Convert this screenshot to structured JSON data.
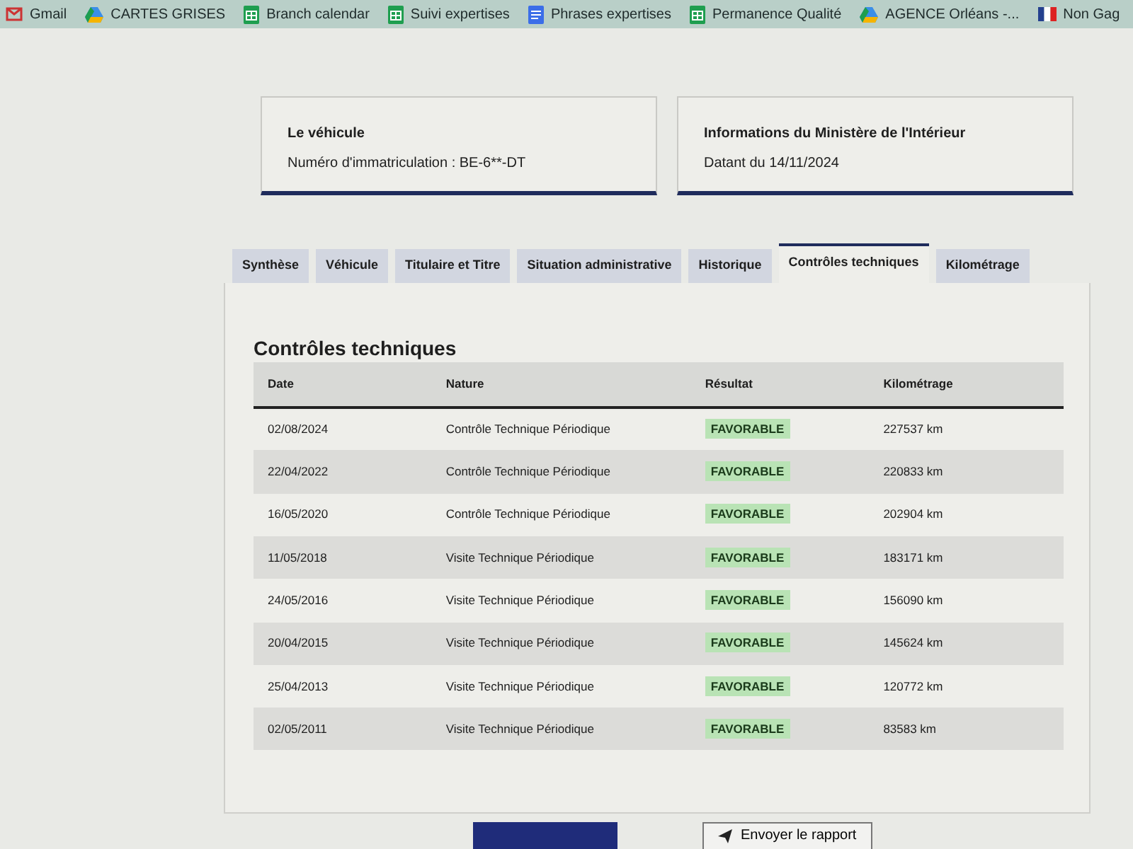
{
  "bookmarks": [
    {
      "label": "Gmail",
      "kind": "mail"
    },
    {
      "label": "CARTES GRISES",
      "kind": "drive"
    },
    {
      "label": "Branch calendar",
      "kind": "sheet"
    },
    {
      "label": "Suivi expertises",
      "kind": "sheet"
    },
    {
      "label": "Phrases expertises",
      "kind": "doc"
    },
    {
      "label": "Permanence Qualité",
      "kind": "sheet"
    },
    {
      "label": "AGENCE Orléans -...",
      "kind": "drive"
    },
    {
      "label": "Non Gag",
      "kind": "flag"
    }
  ],
  "info_cards": [
    {
      "title": "Le véhicule",
      "text": "Numéro d'immatriculation : BE-6**-DT"
    },
    {
      "title": "Informations du Ministère de l'Intérieur",
      "text": "Datant du 14/11/2024"
    }
  ],
  "tabs": [
    {
      "label": "Synthèse",
      "selected": false
    },
    {
      "label": "Véhicule",
      "selected": false
    },
    {
      "label": "Titulaire et Titre",
      "selected": false
    },
    {
      "label": "Situation administrative",
      "selected": false
    },
    {
      "label": "Historique",
      "selected": false
    },
    {
      "label": "Contrôles techniques",
      "selected": true
    },
    {
      "label": "Kilométrage",
      "selected": false
    }
  ],
  "section_title": "Contrôles techniques",
  "table": {
    "columns": [
      "Date",
      "Nature",
      "Résultat",
      "Kilométrage"
    ],
    "rows": [
      {
        "date": "02/08/2024",
        "nature": "Contrôle Technique Périodique",
        "result": "FAVORABLE",
        "mileage": "227537 km"
      },
      {
        "date": "22/04/2022",
        "nature": "Contrôle Technique Périodique",
        "result": "FAVORABLE",
        "mileage": "220833 km"
      },
      {
        "date": "16/05/2020",
        "nature": "Contrôle Technique Périodique",
        "result": "FAVORABLE",
        "mileage": "202904 km"
      },
      {
        "date": "11/05/2018",
        "nature": "Visite Technique Périodique",
        "result": "FAVORABLE",
        "mileage": "183171 km"
      },
      {
        "date": "24/05/2016",
        "nature": "Visite Technique Périodique",
        "result": "FAVORABLE",
        "mileage": "156090 km"
      },
      {
        "date": "20/04/2015",
        "nature": "Visite Technique Périodique",
        "result": "FAVORABLE",
        "mileage": "145624 km"
      },
      {
        "date": "25/04/2013",
        "nature": "Visite Technique Périodique",
        "result": "FAVORABLE",
        "mileage": "120772 km"
      },
      {
        "date": "02/05/2011",
        "nature": "Visite Technique Périodique",
        "result": "FAVORABLE",
        "mileage": "83583 km"
      }
    ]
  },
  "send_report_button": {
    "label": "Envoyer le rapport"
  }
}
